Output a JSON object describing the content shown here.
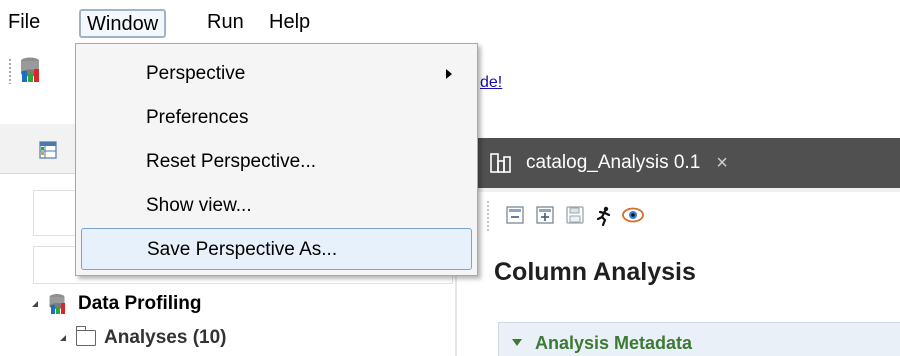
{
  "menubar": {
    "items": [
      {
        "label": "File"
      },
      {
        "label": "Window"
      },
      {
        "label": "Run"
      },
      {
        "label": "Help"
      }
    ]
  },
  "toolbar": {
    "link_text": "de!"
  },
  "window_menu": {
    "items": [
      {
        "label": "Perspective",
        "has_submenu": true
      },
      {
        "label": "Preferences"
      },
      {
        "label": "Reset Perspective..."
      },
      {
        "label": "Show view..."
      },
      {
        "label": "Save Perspective As...",
        "highlighted": true
      }
    ]
  },
  "left_view": {
    "tree": [
      {
        "label": "Data Profiling",
        "expanded": true,
        "icon": "database-icon"
      },
      {
        "label": "Analyses (10)",
        "expanded": true,
        "icon": "folder-icon"
      }
    ]
  },
  "editor": {
    "tab_label": "catalog_Analysis 0.1",
    "tab_close": "×",
    "title": "Column Analysis",
    "section_label": "Analysis Metadata"
  },
  "colors": {
    "tab_bg": "#505050",
    "menu_bg": "#f5f5f5",
    "menu_highlight": "#e7f1fb",
    "section_text": "#3d7a33"
  }
}
